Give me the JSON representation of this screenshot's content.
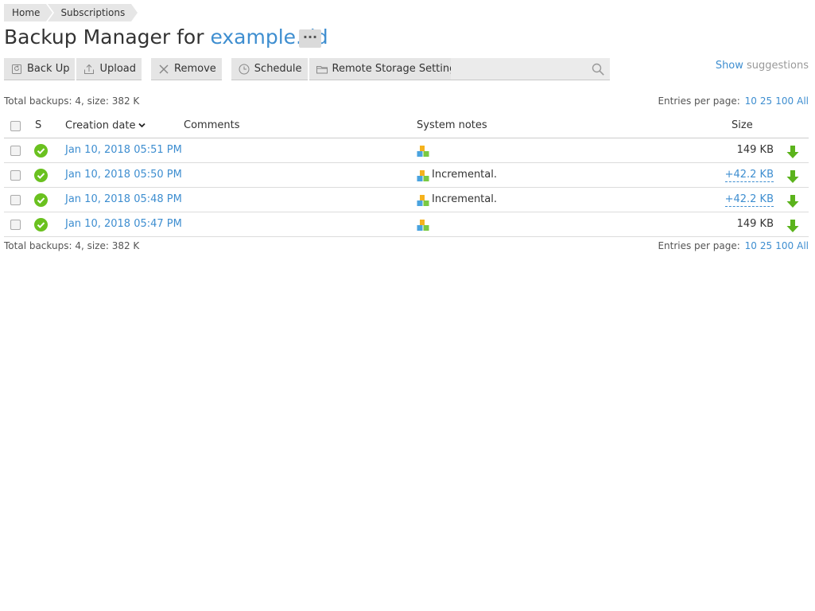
{
  "breadcrumbs": [
    "Home",
    "Subscriptions"
  ],
  "title": {
    "prefix": "Backup Manager for ",
    "domain": "example.tld",
    "more": "···"
  },
  "toolbar": {
    "back_up": "Back Up",
    "upload": "Upload",
    "remove": "Remove",
    "schedule": "Schedule",
    "remote_storage": "Remote Storage Settings"
  },
  "search": {
    "value": "",
    "placeholder": ""
  },
  "suggestions": {
    "show": "Show",
    "rest": " suggestions"
  },
  "totals": "Total backups: 4, size: 382 K",
  "entries": {
    "label": "Entries per page:",
    "options": [
      "10",
      "25",
      "100",
      "All"
    ]
  },
  "columns": {
    "s": "S",
    "date": "Creation date",
    "comments": "Comments",
    "notes": "System notes",
    "size": "Size"
  },
  "rows": [
    {
      "date": "Jan 10, 2018 05:51 PM",
      "comment": "",
      "note": "",
      "size": "149 KB",
      "size_link": false
    },
    {
      "date": "Jan 10, 2018 05:50 PM",
      "comment": "",
      "note": "Incremental.",
      "size": "+42.2 KB",
      "size_link": true
    },
    {
      "date": "Jan 10, 2018 05:48 PM",
      "comment": "",
      "note": "Incremental.",
      "size": "+42.2 KB",
      "size_link": true
    },
    {
      "date": "Jan 10, 2018 05:47 PM",
      "comment": "",
      "note": "",
      "size": "149 KB",
      "size_link": false
    }
  ],
  "colors": {
    "link": "#3e8ed0",
    "success": "#6ac11f",
    "download": "#5bb31c"
  }
}
